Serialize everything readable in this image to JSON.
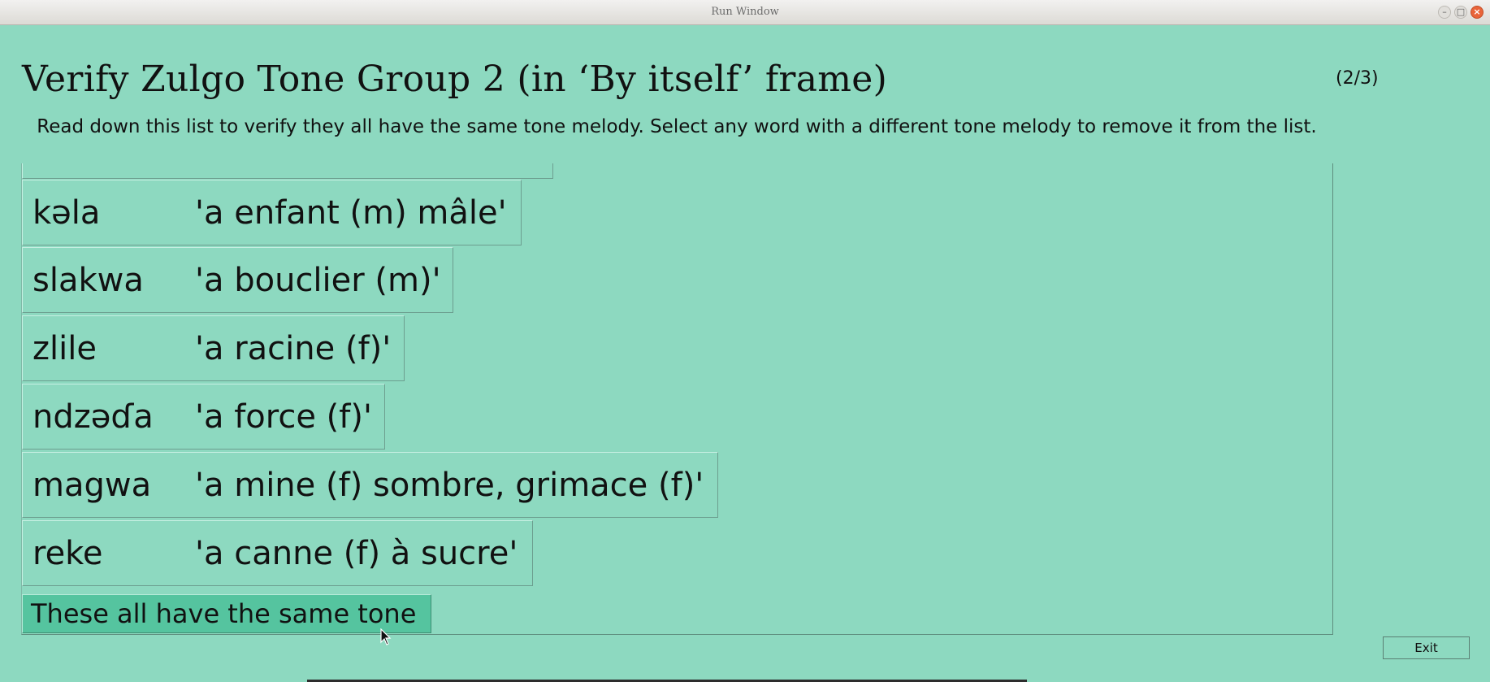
{
  "window": {
    "title": "Run Window",
    "controls": {
      "minimize": "–",
      "maximize": "□",
      "close": "×"
    }
  },
  "header": {
    "title": "Verify Zulgo Tone Group 2 (in ‘By itself’ frame)",
    "progress": "(2/3)",
    "instructions": "Read down this list to verify they all have the same tone melody. Select any word with a different tone melody to remove it from the list."
  },
  "word_list": [
    {
      "form": "kəla",
      "gloss": "'a enfant (m) mâle'"
    },
    {
      "form": "slakwa",
      "gloss": "'a bouclier (m)'"
    },
    {
      "form": "zlile",
      "gloss": "'a racine (f)'"
    },
    {
      "form": "ndzəɗa",
      "gloss": "'a force (f)'"
    },
    {
      "form": "magwa",
      "gloss": "'a mine (f) sombre, grimace (f)'"
    },
    {
      "form": "reke",
      "gloss": "'a canne (f) à sucre'"
    }
  ],
  "buttons": {
    "same_tone": "These all have the same tone",
    "exit": "Exit"
  },
  "colors": {
    "background": "#8dd9c0",
    "button_highlight": "#55c49f",
    "close_button": "#e9643a"
  }
}
